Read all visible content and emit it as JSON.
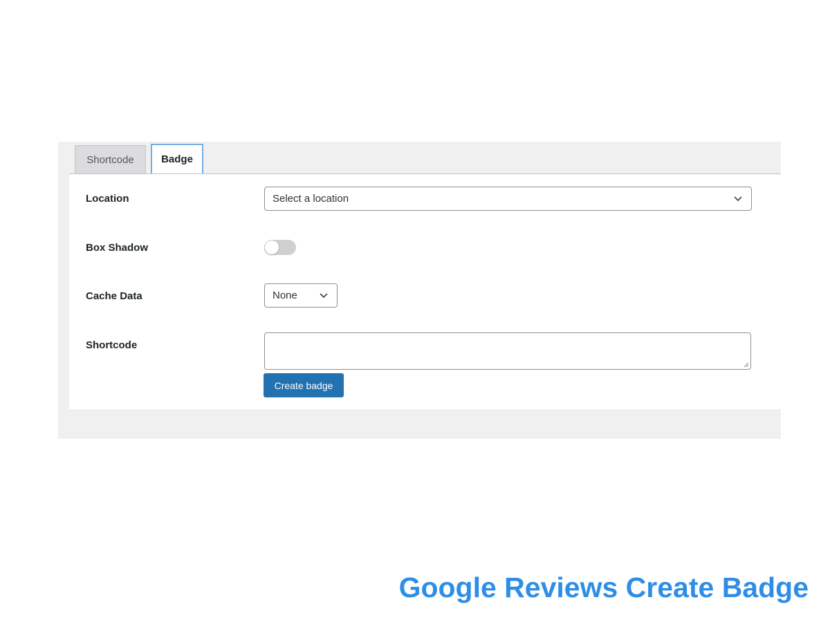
{
  "tabs": [
    {
      "label": "Shortcode",
      "active": false
    },
    {
      "label": "Badge",
      "active": true
    }
  ],
  "form": {
    "location": {
      "label": "Location",
      "value": "Select a location"
    },
    "box_shadow": {
      "label": "Box Shadow",
      "enabled": false
    },
    "cache_data": {
      "label": "Cache Data",
      "value": "None"
    },
    "shortcode": {
      "label": "Shortcode",
      "value": ""
    },
    "create_button": "Create badge"
  },
  "caption": "Google Reviews Create Badge",
  "colors": {
    "accent_button": "#2271b1",
    "caption": "#2e8ee6",
    "active_tab_border": "#72aee6",
    "panel_bg": "#f0f0f1"
  },
  "icons": {
    "select_chevron": "chevron-down-icon",
    "textarea_resize": "resize-handle-icon"
  }
}
